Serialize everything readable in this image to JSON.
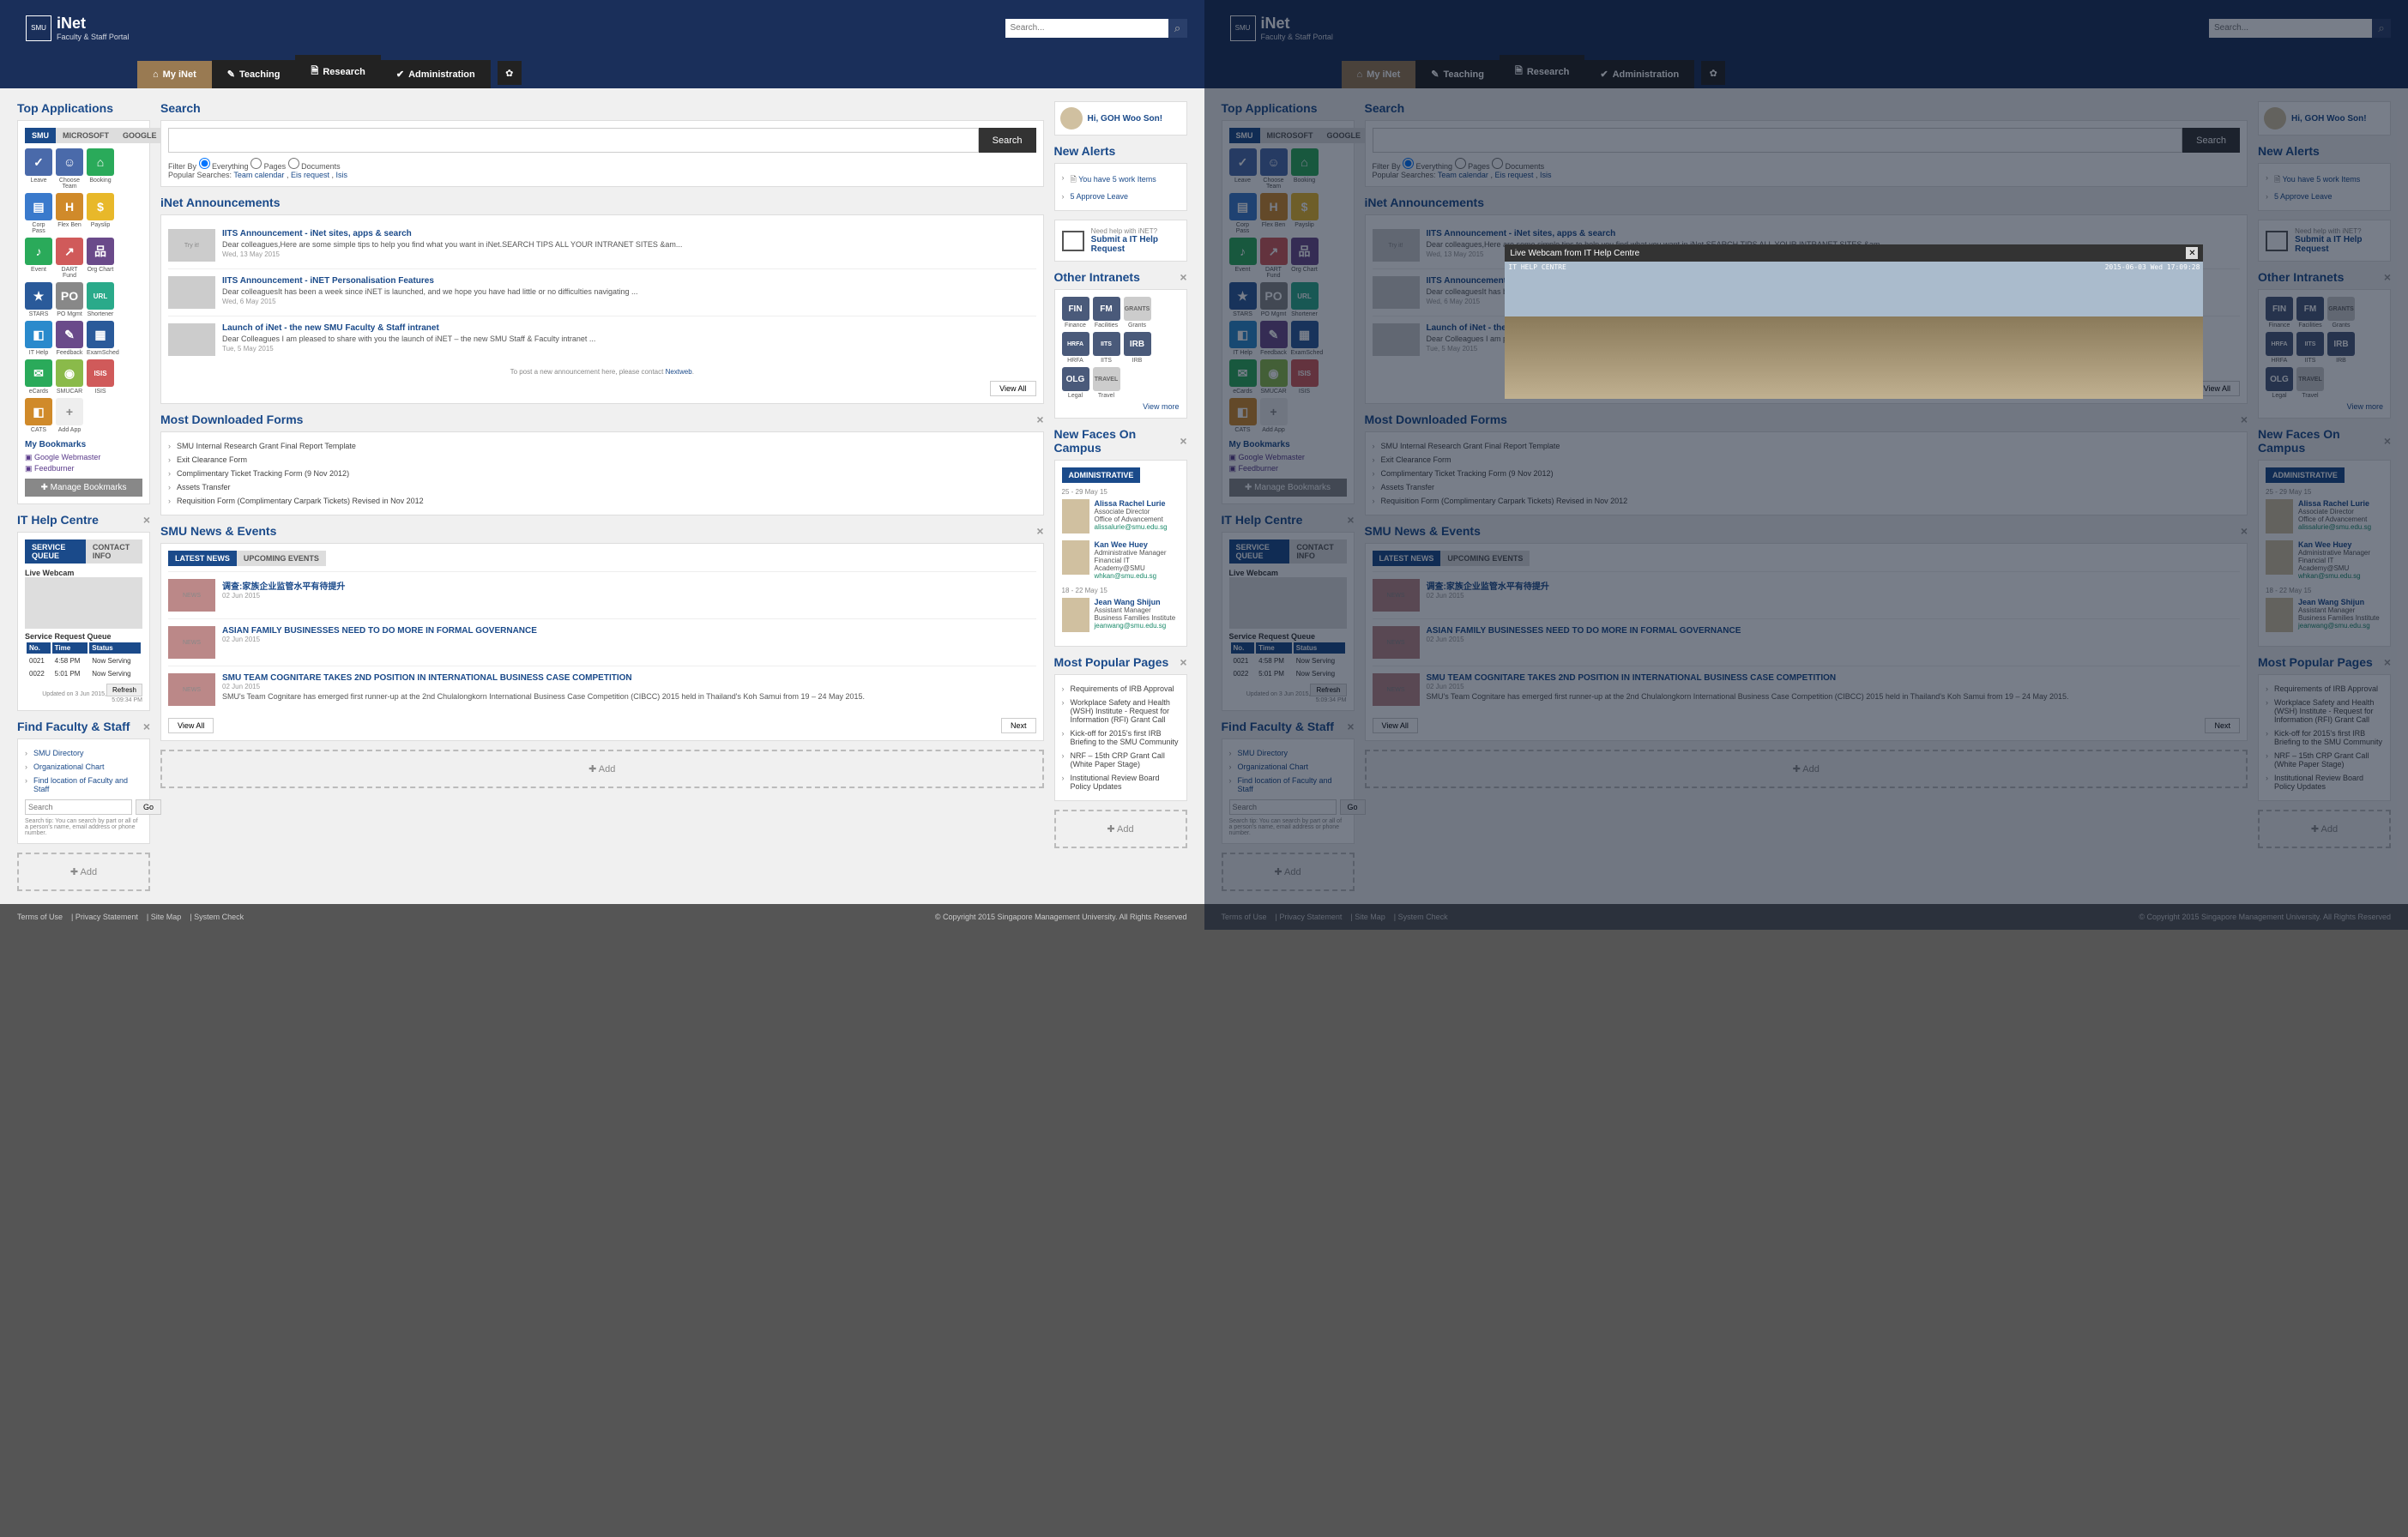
{
  "logo": {
    "name": "iNet",
    "sub": "Faculty & Staff Portal",
    "smu": "SMU"
  },
  "search": {
    "placeholder": "Search...",
    "icon": "⌕"
  },
  "nav": [
    {
      "label": "My iNet",
      "active": true,
      "icon": "⌂"
    },
    {
      "label": "Teaching",
      "icon": "✎"
    },
    {
      "label": "Research",
      "icon": "🗎"
    },
    {
      "label": "Administration",
      "icon": "✔"
    }
  ],
  "gear": "✿",
  "topApps": {
    "title": "Top Applications",
    "providers": [
      "SMU",
      "MICROSOFT",
      "GOOGLE"
    ],
    "apps": [
      {
        "label": "Leave",
        "bg": "#4a6aaa",
        "glyph": "✓"
      },
      {
        "label": "Choose Team",
        "bg": "#4a6aaa",
        "glyph": "☺"
      },
      {
        "label": "Booking",
        "bg": "#2aaa5a",
        "glyph": "⌂"
      },
      {
        "label": "Corp Pass",
        "bg": "#3a7acc",
        "glyph": "▤"
      },
      {
        "label": "Flex Ben",
        "bg": "#d08a2a",
        "glyph": "H"
      },
      {
        "label": "Payslip",
        "bg": "#e8b82a",
        "glyph": "$"
      },
      {
        "label": "Event",
        "bg": "#2aaa5a",
        "glyph": "♪"
      },
      {
        "label": "DART Fund",
        "bg": "#d05a5a",
        "glyph": "↗"
      },
      {
        "label": "Org Chart",
        "bg": "#6a4a8a",
        "glyph": "品"
      },
      {
        "label": "STARS",
        "bg": "#2a5a9a",
        "glyph": "★"
      },
      {
        "label": "PO Mgmt",
        "bg": "#888",
        "glyph": "PO"
      },
      {
        "label": "Shortener",
        "bg": "#2aaa8a",
        "glyph": "URL"
      },
      {
        "label": "IT Help",
        "bg": "#2a8acc",
        "glyph": "◧"
      },
      {
        "label": "Feedback",
        "bg": "#6a4a8a",
        "glyph": "✎"
      },
      {
        "label": "ExamSched",
        "bg": "#2a5a9a",
        "glyph": "▦"
      },
      {
        "label": "eCards",
        "bg": "#2aaa5a",
        "glyph": "✉"
      },
      {
        "label": "SMUCAR",
        "bg": "#8aba4a",
        "glyph": "◉"
      },
      {
        "label": "ISIS",
        "bg": "#d05a5a",
        "glyph": "ISIS"
      },
      {
        "label": "CATS",
        "bg": "#d08a2a",
        "glyph": "◧"
      },
      {
        "label": "Add App",
        "bg": "#eee",
        "glyph": "+",
        "fg": "#888"
      }
    ],
    "bookmarksTitle": "My Bookmarks",
    "bookmarks": [
      "Google Webmaster",
      "Feedburner"
    ],
    "manage": "✚ Manage Bookmarks"
  },
  "itHelp": {
    "title": "IT Help Centre",
    "tabs": [
      "SERVICE QUEUE",
      "CONTACT INFO"
    ],
    "webcam": "Live Webcam",
    "queueTitle": "Service Request Queue",
    "cols": [
      "No.",
      "Time",
      "Status"
    ],
    "rows": [
      {
        "no": "0021",
        "time": "4:58 PM",
        "status": "Now Serving"
      },
      {
        "no": "0022",
        "time": "5:01 PM",
        "status": "Now Serving"
      }
    ],
    "refresh": "Refresh",
    "updated": "Updated on 3 Jun 2015, 5:09:34 PM"
  },
  "find": {
    "title": "Find Faculty & Staff",
    "links": [
      "SMU Directory",
      "Organizational Chart",
      "Find location of Faculty and Staff"
    ],
    "placeholder": "Search",
    "go": "Go",
    "tip": "Search tip: You can search by part or all of a person's name, email address or phone number."
  },
  "search2": {
    "title": "Search",
    "btn": "Search",
    "filter": "Filter By",
    "opts": [
      "Everything",
      "Pages",
      "Documents"
    ],
    "popular": "Popular Searches:",
    "terms": [
      "Team calendar",
      "Eis request",
      "Isis"
    ]
  },
  "anns": {
    "title": "iNet Announcements",
    "items": [
      {
        "title": "IITS Announcement - iNet sites, apps & search",
        "desc": "Dear colleagues,Here are some simple tips to help you find what you want in iNet.SEARCH TIPS ALL YOUR INTRANET SITES &am...",
        "date": "Wed, 13 May 2015",
        "th": "Try it!"
      },
      {
        "title": "IITS Announcement - iNET Personalisation Features",
        "desc": "Dear colleaguesIt has been a week since iNET is launched, and we hope you have had little or no difficulties navigating ...",
        "date": "Wed, 6 May 2015",
        "th": ""
      },
      {
        "title": "Launch of iNet - the new SMU Faculty & Staff intranet",
        "desc": "Dear Colleagues I am pleased to share with you the launch of iNET – the new SMU Staff & Faculty intranet ...",
        "date": "Tue, 5 May 2015",
        "th": ""
      }
    ],
    "post": "To post a new announcement here, please contact ",
    "postLink": "Nextweb",
    "viewAll": "View All"
  },
  "forms": {
    "title": "Most Downloaded Forms",
    "items": [
      "SMU Internal Research Grant Final Report Template",
      "Exit Clearance Form",
      "Complimentary Ticket Tracking Form (9 Nov 2012)",
      "Assets Transfer",
      "Requisition Form (Complimentary Carpark Tickets) Revised in Nov 2012"
    ]
  },
  "news": {
    "title": "SMU News & Events",
    "tabs": [
      "LATEST NEWS",
      "UPCOMING EVENTS"
    ],
    "items": [
      {
        "title": "调查:家族企业监管水平有待提升",
        "date": "02 Jun 2015"
      },
      {
        "title": "ASIAN FAMILY BUSINESSES NEED TO DO MORE IN FORMAL GOVERNANCE",
        "date": "02 Jun 2015"
      },
      {
        "title": "SMU TEAM COGNITARE TAKES 2ND POSITION IN INTERNATIONAL BUSINESS CASE COMPETITION",
        "date": "02 Jun 2015",
        "desc": "SMU's Team Cognitare has emerged first runner-up at the 2nd Chulalongkorn International Business Case Competition (CIBCC) 2015 held in Thailand's Koh Samui from 19 – 24 May 2015."
      }
    ],
    "viewAll": "View All",
    "next": "Next"
  },
  "greet": "Hi, GOH Woo Son!",
  "alerts": {
    "title": "New Alerts",
    "items": [
      "You have 5 work Items",
      "5 Approve Leave"
    ]
  },
  "helpReq": {
    "q": "Need help with iNET?",
    "a": "Submit a IT Help Request"
  },
  "intranets": {
    "title": "Other Intranets",
    "tiles": [
      {
        "code": "FIN",
        "label": "Finance"
      },
      {
        "code": "FM",
        "label": "Facilities"
      },
      {
        "code": "GRANTS",
        "label": "Grants",
        "dim": true
      },
      {
        "code": "HRFA",
        "label": "HRFA"
      },
      {
        "code": "IITS",
        "label": "IITS"
      },
      {
        "code": "IRB",
        "label": "IRB"
      },
      {
        "code": "OLG",
        "label": "Legal"
      },
      {
        "code": "TRAVEL",
        "label": "Travel",
        "dim": true
      }
    ],
    "more": "View more"
  },
  "faces": {
    "title": "New Faces On Campus",
    "tab": "ADMINISTRATIVE",
    "range1": "25 - 29 May 15",
    "range2": "18 - 22 May 15",
    "people": [
      {
        "name": "Alissa Rachel Lurie",
        "role": "Associate Director",
        "dept": "Office of Advancement",
        "email": "alissalurie@smu.edu.sg",
        "r": 1
      },
      {
        "name": "Kan Wee Huey",
        "role": "Administrative Manager",
        "dept": "Financial IT Academy@SMU",
        "email": "whkan@smu.edu.sg",
        "r": 1
      },
      {
        "name": "Jean Wang Shijun",
        "role": "Assistant Manager",
        "dept": "Business Families Institute",
        "email": "jeanwang@smu.edu.sg",
        "r": 2
      }
    ]
  },
  "popular": {
    "title": "Most Popular Pages",
    "items": [
      "Requirements of IRB Approval",
      "Workplace Safety and Health (WSH) Institute - Request for Information (RFI) Grant Call",
      "Kick-off for 2015's first IRB Briefing to the SMU Community",
      "NRF – 15th CRP Grant Call (White Paper Stage)",
      "Institutional Review Board Policy Updates"
    ]
  },
  "add": "✚ Add",
  "footer": {
    "links": [
      "Terms of Use",
      "Privacy Statement",
      "Site Map",
      "System Check"
    ],
    "copy": "© Copyright 2015 Singapore Management University. All Rights Reserved"
  },
  "modal": {
    "title": "Live Webcam from IT Help Centre",
    "ts": "2015-06-03 Wed 17:09:28",
    "hc": "IT HELP CENTRE"
  }
}
